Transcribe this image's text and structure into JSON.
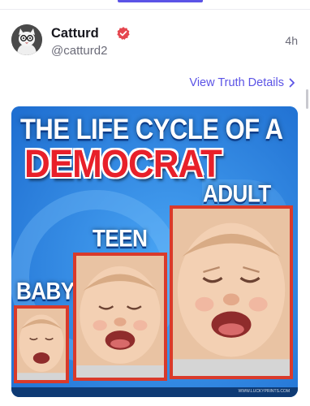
{
  "post": {
    "display_name": "Catturd",
    "handle": "@catturd2",
    "time": "4h",
    "verified_color": "#e5464f",
    "avatar_icon": "cat-with-glasses-avatar"
  },
  "links": {
    "view_details": "View Truth Details"
  },
  "media": {
    "title_line1": "THE LIFE CYCLE OF A",
    "title_line2": "DEMOCRAT",
    "stages": [
      "ADULT",
      "TEEN",
      "BABY"
    ],
    "credit": "WWW.LUCKYPRINTS.COM",
    "accent_blue": "#2f89e8",
    "frame_red": "#d93a2b"
  },
  "colors": {
    "link": "#5b53e6",
    "text_primary": "#16161d",
    "text_secondary": "#6b6b78"
  }
}
